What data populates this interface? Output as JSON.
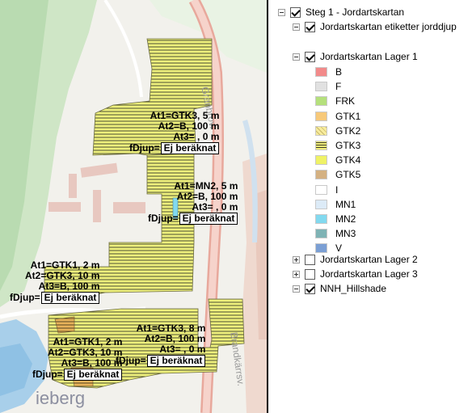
{
  "map": {
    "place_fragment": "ieberg",
    "road_label_upper": "Granbrov.",
    "road_label_lower": "Brandkärrsv.",
    "labels": [
      {
        "id": "label-1",
        "rows": [
          "At1=GTK3, 5 m",
          "At2=B, 100 m",
          "At3= , 0 m"
        ],
        "fdjup_prefix": "fDjup=",
        "fdjup_value": "Ej beräknat"
      },
      {
        "id": "label-2",
        "rows": [
          "At1=MN2, 5 m",
          "At2=B, 100 m",
          "At3= , 0 m"
        ],
        "fdjup_prefix": "fDjup=",
        "fdjup_value": "Ej beräknat"
      },
      {
        "id": "label-3",
        "rows": [
          "At1=GTK1, 2 m",
          "At2=GTK3, 10 m",
          "At3=B, 100 m"
        ],
        "fdjup_prefix": "fDjup=",
        "fdjup_value": "Ej beräknat"
      },
      {
        "id": "label-4",
        "rows": [
          "At1=GTK3, 8 m",
          "At2=B, 100 m",
          "At3= , 0 m"
        ],
        "fdjup_prefix": "fDjup=",
        "fdjup_value": "Ej beräknat"
      },
      {
        "id": "label-5",
        "rows": [
          "At1=GTK1, 2 m",
          "At2=GTK3, 10 m",
          "At3=B, 100 m"
        ],
        "fdjup_prefix": "fDjup=",
        "fdjup_value": "Ej beräknat"
      }
    ]
  },
  "toc": {
    "root": {
      "label": "Steg 1 - Jordartskartan",
      "expanded": true,
      "checked": true
    },
    "labels_layer": {
      "label": "Jordartskartan etiketter jorddjup",
      "expanded": true,
      "checked": true
    },
    "layer1": {
      "label": "Jordartskartan Lager 1",
      "expanded": true,
      "checked": true
    },
    "legend_items": [
      {
        "label": "B",
        "color": "#f28a8a",
        "pattern": "solid"
      },
      {
        "label": "F",
        "color": "#e1e1e1",
        "pattern": "solid"
      },
      {
        "label": "FRK",
        "color": "#b5e07c",
        "pattern": "solid"
      },
      {
        "label": "GTK1",
        "color": "#f7c97a",
        "pattern": "solid"
      },
      {
        "label": "GTK2",
        "color": "#f7ec9e",
        "pattern": "diagonal"
      },
      {
        "label": "GTK3",
        "color": "#f3f07a",
        "pattern": "hlines"
      },
      {
        "label": "GTK4",
        "color": "#eff266",
        "pattern": "solid"
      },
      {
        "label": "GTK5",
        "color": "#d4b182",
        "pattern": "solid"
      },
      {
        "label": "I",
        "color": "#ffffff",
        "pattern": "solid"
      },
      {
        "label": "MN1",
        "color": "#dcebf7",
        "pattern": "solid"
      },
      {
        "label": "MN2",
        "color": "#82d9ef",
        "pattern": "solid"
      },
      {
        "label": "MN3",
        "color": "#7fb3b5",
        "pattern": "solid"
      },
      {
        "label": "V",
        "color": "#7b9fd4",
        "pattern": "solid"
      }
    ],
    "layer2": {
      "label": "Jordartskartan Lager 2",
      "expanded": false,
      "checked": false
    },
    "layer3": {
      "label": "Jordartskartan Lager 3",
      "expanded": false,
      "checked": false
    },
    "hillshade": {
      "label": "NNH_Hillshade",
      "expanded": true,
      "checked": true
    }
  }
}
